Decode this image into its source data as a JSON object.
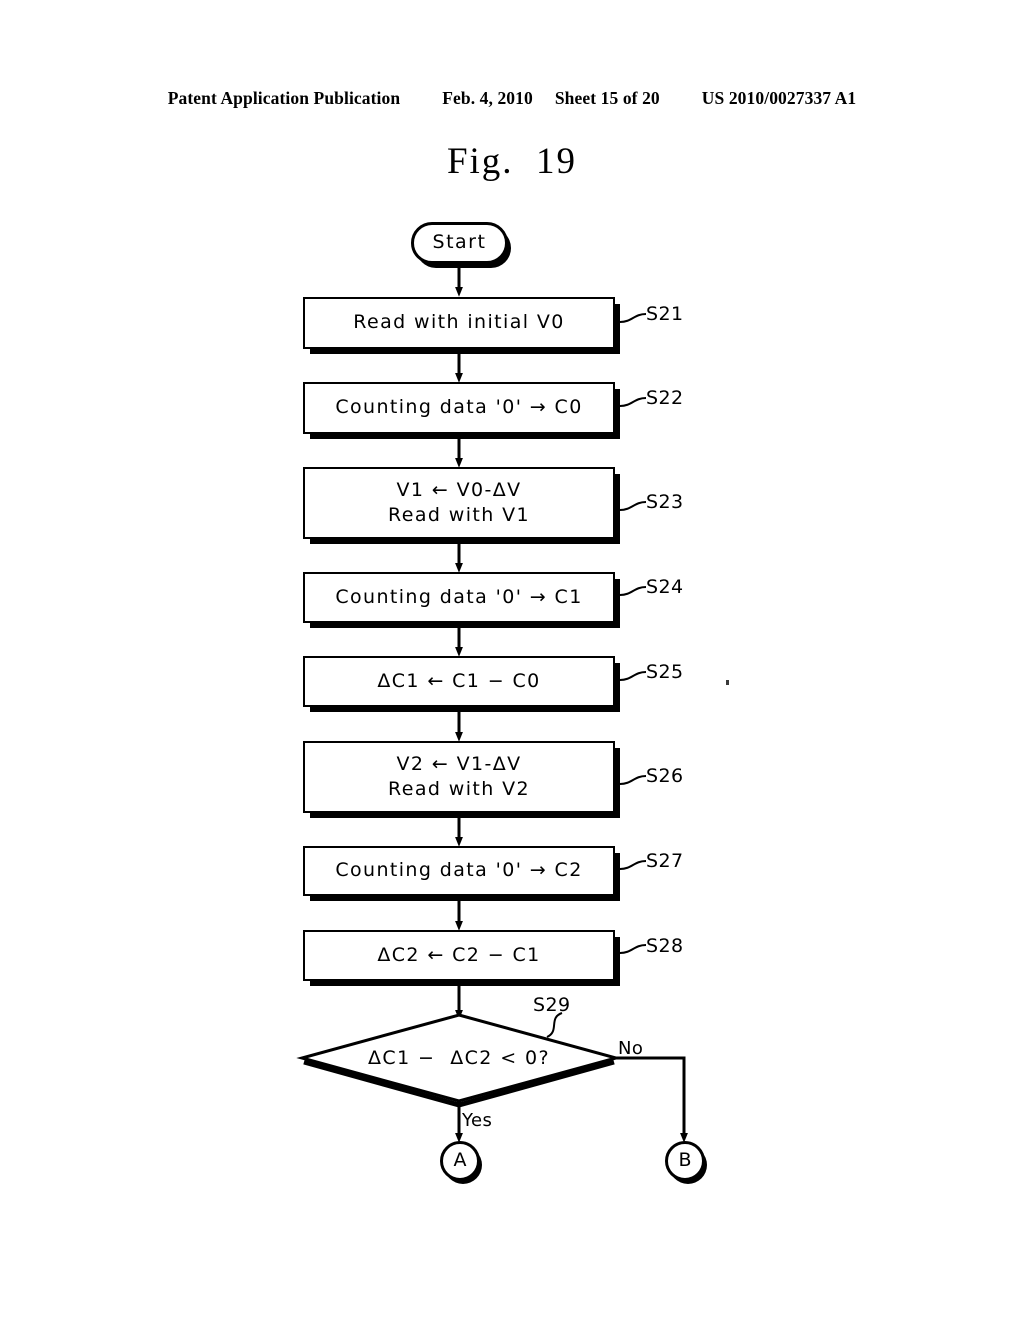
{
  "header": {
    "publication": "Patent Application Publication",
    "date": "Feb. 4, 2010",
    "sheet": "Sheet 15 of 20",
    "patent_number": "US 2010/0027337 A1"
  },
  "figure": {
    "title": "Fig.  19"
  },
  "flowchart": {
    "start": {
      "label": "Start"
    },
    "steps": [
      {
        "id": "S21",
        "text": "Read with initial V0",
        "ref": "S21"
      },
      {
        "id": "S22",
        "text": "Counting data '0'  →  C0",
        "ref": "S22"
      },
      {
        "id": "S23",
        "text": "V1  ←  V0-ΔV\nRead with V1",
        "ref": "S23"
      },
      {
        "id": "S24",
        "text": "Counting data '0'  →  C1",
        "ref": "S24"
      },
      {
        "id": "S25",
        "text": "ΔC1  ←  C1 − C0",
        "ref": "S25"
      },
      {
        "id": "S26",
        "text": "V2  ←  V1-ΔV\nRead with V2",
        "ref": "S26"
      },
      {
        "id": "S27",
        "text": "Counting data '0'  →  C2",
        "ref": "S27"
      },
      {
        "id": "S28",
        "text": "ΔC2  ←  C2 − C1",
        "ref": "S28"
      }
    ],
    "decision": {
      "id": "S29",
      "text": "ΔC1 −  ΔC2 < 0?",
      "ref": "S29",
      "yes_label": "Yes",
      "no_label": "No"
    },
    "connectors": [
      {
        "id": "A",
        "label": "A"
      },
      {
        "id": "B",
        "label": "B"
      }
    ]
  },
  "colors": {
    "ink": "#000000",
    "paper": "#ffffff"
  }
}
